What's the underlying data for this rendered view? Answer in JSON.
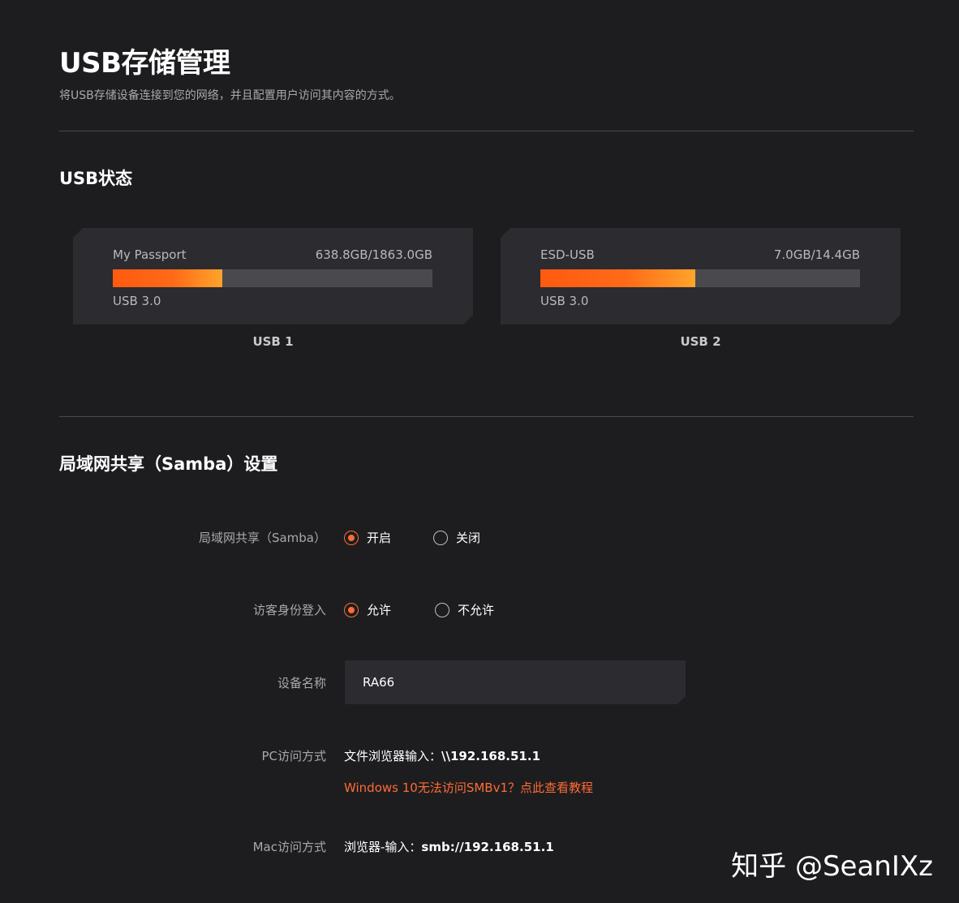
{
  "header": {
    "title": "USB存储管理",
    "subtitle": "将USB存储设备连接到您的网络，并且配置用户访问其内容的方式。"
  },
  "usb_status": {
    "title": "USB状态",
    "devices": [
      {
        "name": "My Passport",
        "capacity": "638.8GB/1863.0GB",
        "used_fraction": 0.343,
        "version": "USB 3.0",
        "port": "USB 1"
      },
      {
        "name": "ESD-USB",
        "capacity": "7.0GB/14.4GB",
        "used_fraction": 0.486,
        "version": "USB 3.0",
        "port": "USB 2"
      }
    ]
  },
  "samba": {
    "title": "局域网共享（Samba）设置",
    "sharing": {
      "label": "局域网共享（Samba）",
      "options": [
        {
          "label": "开启",
          "selected": true
        },
        {
          "label": "关闭",
          "selected": false
        }
      ]
    },
    "guest": {
      "label": "访客身份登入",
      "options": [
        {
          "label": "允许",
          "selected": true
        },
        {
          "label": "不允许",
          "selected": false
        }
      ]
    },
    "device_name": {
      "label": "设备名称",
      "value": "RA66"
    },
    "pc_access": {
      "label": "PC访问方式",
      "prefix": "文件浏览器输入：",
      "address": "\\\\192.168.51.1",
      "help_link": "Windows 10无法访问SMBv1？点此查看教程"
    },
    "mac_access": {
      "label": "Mac访问方式",
      "prefix": "浏览器-输入：",
      "address": "smb://192.168.51.1"
    }
  },
  "watermark": "知乎 @SeanIXz",
  "colors": {
    "accent": "#ff6b35",
    "background": "#1d1d1f",
    "card": "#2b2b30",
    "bar_track": "#4a4a4e"
  }
}
